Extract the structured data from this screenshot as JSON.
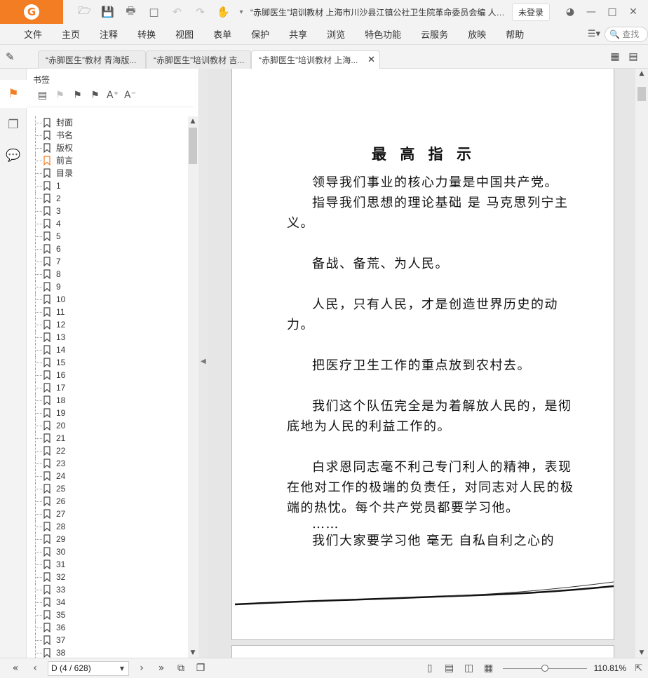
{
  "titlebar": {
    "quick_access": [
      "open-folder-icon",
      "save-icon",
      "print-icon",
      "export-icon",
      "undo-icon",
      "redo-icon",
      "hand-tool-icon",
      "dropdown-icon"
    ],
    "document_title": "“赤脚医生”培训教材 上海市川沙县江镇公社卫生院革命委员会编 人民...",
    "login_label": "未登录",
    "window_controls": [
      "skin-icon",
      "minimize-icon",
      "maximize-icon",
      "close-icon"
    ]
  },
  "menu": {
    "items": [
      "文件",
      "主页",
      "注释",
      "转换",
      "视图",
      "表单",
      "保护",
      "共享",
      "浏览",
      "特色功能",
      "云服务",
      "放映",
      "帮助"
    ],
    "search_placeholder": "查找"
  },
  "tabs": [
    {
      "label": "“赤脚医生”教材 青海版...",
      "active": false
    },
    {
      "label": "“赤脚医生”培训教材 吉...",
      "active": false
    },
    {
      "label": "“赤脚医生”培训教材 上海...",
      "active": true
    }
  ],
  "left_rail": [
    "bookmark-icon",
    "page-thumbnails-icon",
    "comments-icon"
  ],
  "bookmarks": {
    "panel_title": "书签",
    "tools": [
      "bookmark-options-icon",
      "add-bookmark-icon",
      "bookmark-icon",
      "bookmark-current-icon",
      "increase-font-icon",
      "decrease-font-icon"
    ],
    "items": [
      "封面",
      "书名",
      "版权",
      "前言",
      "目录",
      "1",
      "2",
      "3",
      "4",
      "5",
      "6",
      "7",
      "8",
      "9",
      "10",
      "11",
      "12",
      "13",
      "14",
      "15",
      "16",
      "17",
      "18",
      "19",
      "20",
      "21",
      "22",
      "23",
      "24",
      "25",
      "26",
      "27",
      "28",
      "29",
      "30",
      "31",
      "32",
      "33",
      "34",
      "35",
      "36",
      "37",
      "38"
    ],
    "active_item": "前言",
    "accent_color": "#f27d22"
  },
  "page": {
    "title": "最 高 指 示",
    "paragraphs": [
      {
        "text": "领导我们事业的核心力量是中国共产党。",
        "gap": false
      },
      {
        "text": "指导我们思想的理论基础 是 马克思列宁主义。",
        "gap": true
      },
      {
        "text": "备战、备荒、为人民。",
        "gap": true
      },
      {
        "text": "人民，只有人民，才是创造世界历史的动力。",
        "gap": true
      },
      {
        "text": "把医疗卫生工作的重点放到农村去。",
        "gap": true
      },
      {
        "text": "我们这个队伍完全是为着解放人民的，是彻底地为人民的利益工作的。",
        "gap": true
      },
      {
        "text": "白求恩同志毫不利己专门利人的精神，表现在他对工作的极端的负责任，对同志对人民的极端的热忱。每个共产党员都要学习他。",
        "gap": false
      },
      {
        "text": "……",
        "gap": false,
        "dots": true
      },
      {
        "text": "我们大家要学习他 毫无 自私自利之心的",
        "gap": false
      }
    ]
  },
  "statusbar": {
    "nav": [
      "first-page-icon",
      "prev-page-icon"
    ],
    "nav_after": [
      "next-page-icon",
      "last-page-icon",
      "rotate-icon",
      "crop-icon"
    ],
    "page_indicator": "D (4 / 628)",
    "view_modes": [
      "single-page-icon",
      "continuous-icon",
      "two-page-icon",
      "thumbnail-view-icon"
    ],
    "zoom_value": "110.81%",
    "zoom_level_fraction": 0.5
  }
}
